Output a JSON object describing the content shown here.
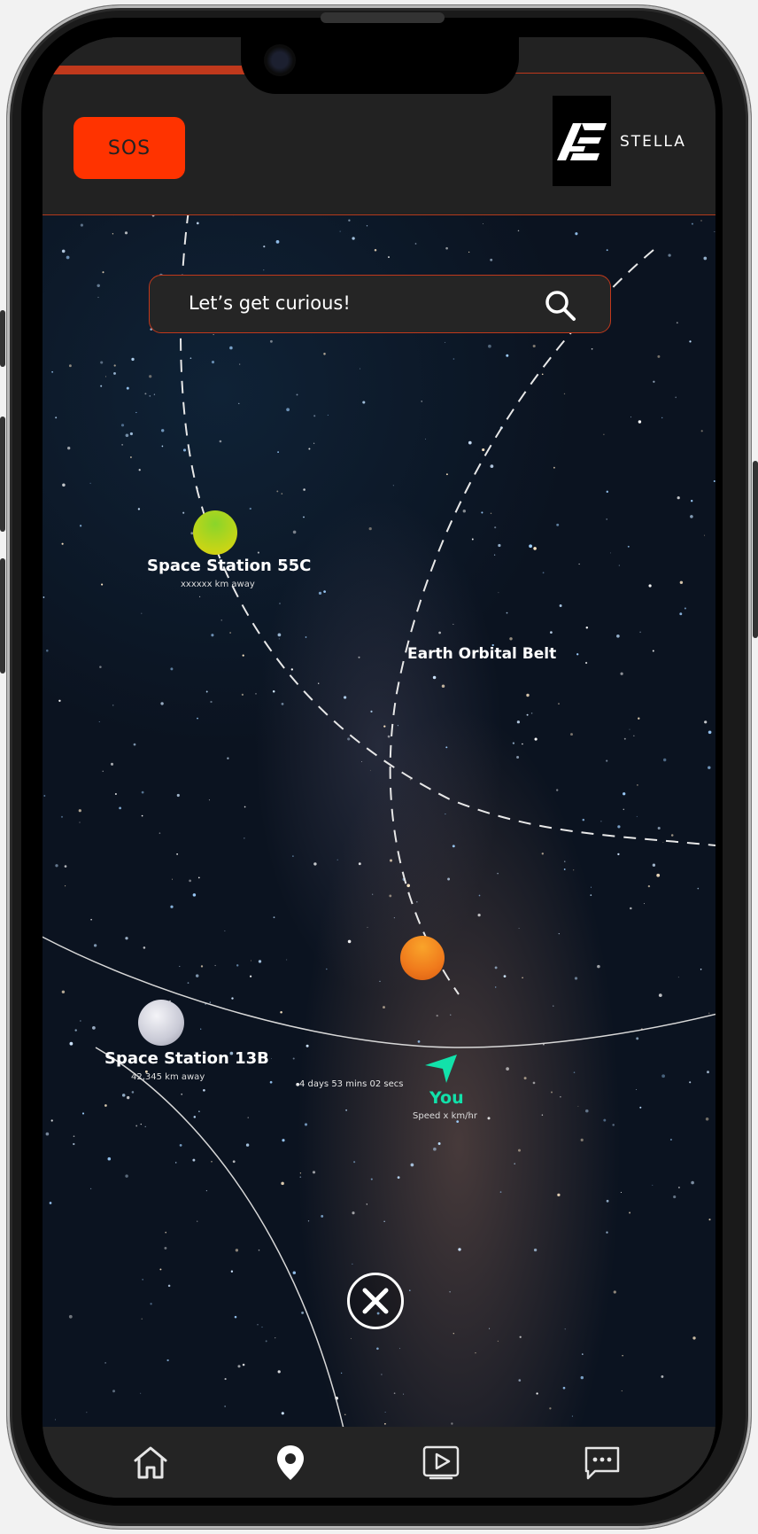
{
  "header": {
    "sos_label": "SOS",
    "brand_name": "STELLA",
    "logo_mark": "AE"
  },
  "search": {
    "placeholder": "Let’s get curious!",
    "icon": "search-icon"
  },
  "map": {
    "belt_label": "Earth Orbital Belt",
    "stations": [
      {
        "name": "Space Station 55C",
        "distance": "xxxxxx km away",
        "color": "#9bd31f"
      },
      {
        "name": "Space Station 13B",
        "distance": "42,345 km away",
        "color": "#c9cad6"
      }
    ],
    "destination_color": "#f07a1c",
    "eta": "4 days 53 mins 02 secs",
    "you": {
      "label": "You",
      "speed": "Speed x km/hr",
      "color": "#12e1aa"
    },
    "close_icon": "close-icon"
  },
  "nav": {
    "items": [
      {
        "name": "home",
        "icon": "home-icon",
        "active": false
      },
      {
        "name": "map",
        "icon": "location-pin-icon",
        "active": true
      },
      {
        "name": "media",
        "icon": "play-icon",
        "active": false
      },
      {
        "name": "messages",
        "icon": "chat-icon",
        "active": false
      }
    ]
  },
  "colors": {
    "accent": "#ff3300",
    "border_accent": "#c0391c",
    "background": "#222222"
  }
}
